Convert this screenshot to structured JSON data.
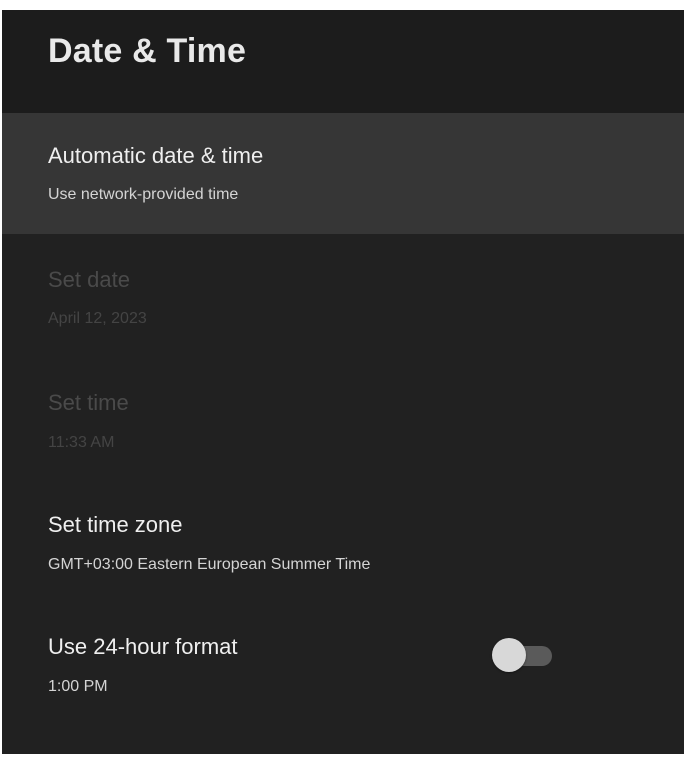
{
  "header": {
    "title": "Date & Time"
  },
  "settings": {
    "items": [
      {
        "title": "Automatic date & time",
        "subtitle": "Use network-provided time",
        "state": "focused"
      },
      {
        "title": "Set date",
        "subtitle": "April 12, 2023",
        "state": "disabled"
      },
      {
        "title": "Set time",
        "subtitle": "11:33 AM",
        "state": "disabled"
      },
      {
        "title": "Set time zone",
        "subtitle": "GMT+03:00 Eastern European Summer Time",
        "state": "enabled"
      },
      {
        "title": "Use 24-hour format",
        "subtitle": "1:00 PM",
        "state": "enabled",
        "toggle": {
          "on": false
        }
      }
    ]
  },
  "colors": {
    "background": "#212121",
    "header_background": "#1c1c1c",
    "focused_row": "#363636",
    "primary_text": "#efefef",
    "disabled_text": "#4a4a4a",
    "toggle_thumb": "#d8d8d8",
    "toggle_track": "#5a5a5a"
  }
}
